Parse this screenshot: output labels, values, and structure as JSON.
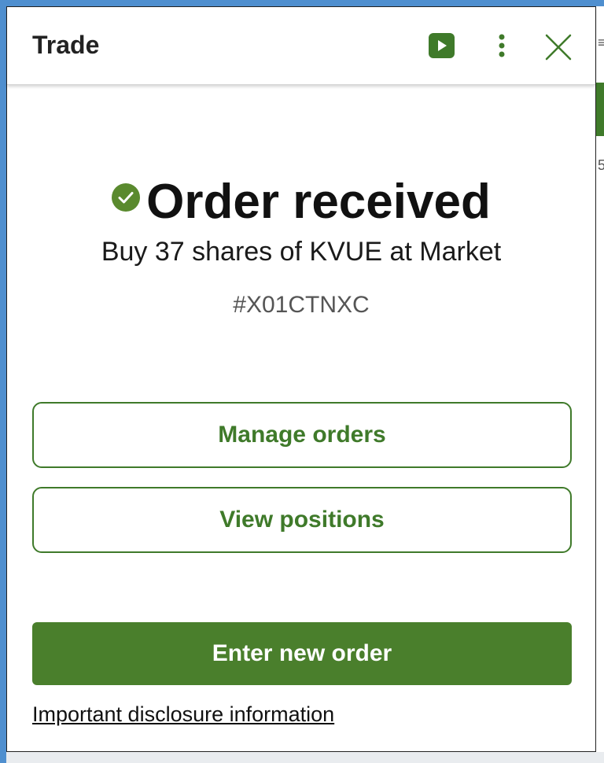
{
  "dialog": {
    "title": "Trade",
    "header_icons": [
      "play-video-icon",
      "more-vertical-icon",
      "close-icon"
    ]
  },
  "confirmation": {
    "title": "Order received",
    "summary": "Buy 37 shares of KVUE at Market",
    "order_id": "#X01CTNXC",
    "status_icon": "check-circle-icon"
  },
  "actions": {
    "manage_orders": "Manage orders",
    "view_positions": "View positions",
    "enter_new_order": "Enter new order"
  },
  "footer": {
    "disclosure_link": "Important disclosure information"
  },
  "colors": {
    "brand_green": "#3f7a2a",
    "primary_button": "#4a7f2c",
    "text": "#111111",
    "muted_text": "#555555"
  }
}
